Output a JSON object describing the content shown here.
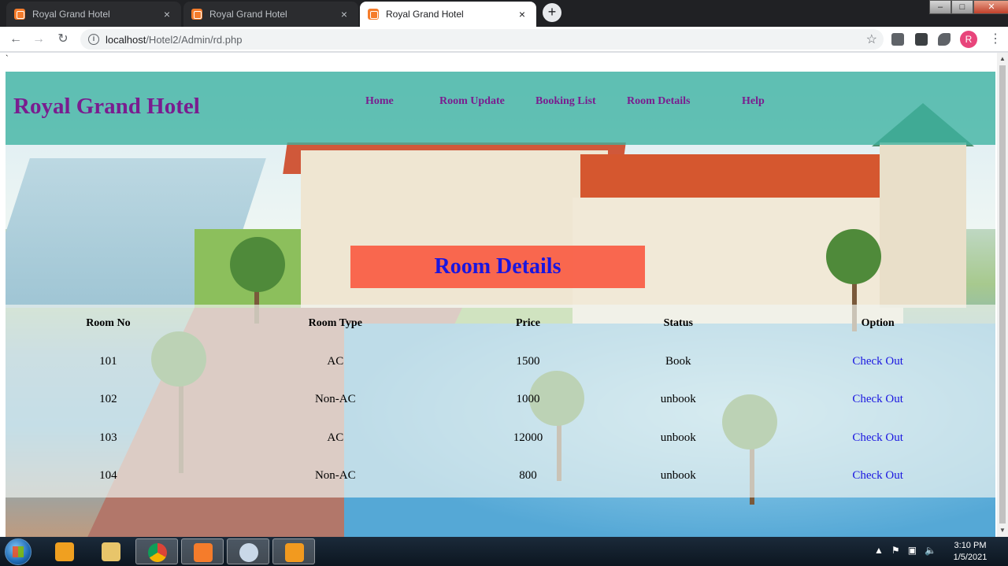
{
  "browser": {
    "tabs": [
      {
        "title": "Royal Grand Hotel",
        "active": false
      },
      {
        "title": "Royal Grand Hotel",
        "active": false
      },
      {
        "title": "Royal Grand Hotel",
        "active": true
      }
    ],
    "close_glyph": "×",
    "new_tab_glyph": "+",
    "url_host": "localhost",
    "url_path": "/Hotel2/Admin/rd.php",
    "profile_initial": "R",
    "window_controls": {
      "minimize": "–",
      "maximize": "□",
      "close": "✕"
    }
  },
  "page": {
    "stray_char": "`",
    "brand": "Royal Grand Hotel",
    "nav": [
      "Home",
      "Room Update",
      "Booking List",
      "Room Details",
      "Help"
    ],
    "heading": "Room Details",
    "table": {
      "headers": [
        "Room No",
        "Room Type",
        "Price",
        "Status",
        "Option"
      ],
      "rows": [
        {
          "room_no": "101",
          "type": "AC",
          "price": "1500",
          "status": "Book",
          "option": "Check Out"
        },
        {
          "room_no": "102",
          "type": "Non-AC",
          "price": "1000",
          "status": "unbook",
          "option": "Check Out"
        },
        {
          "room_no": "103",
          "type": "AC",
          "price": "12000",
          "status": "unbook",
          "option": "Check Out"
        },
        {
          "room_no": "104",
          "type": "Non-AC",
          "price": "800",
          "status": "unbook",
          "option": "Check Out"
        }
      ]
    },
    "colors": {
      "brand": "#7a1d8f",
      "heading": "#1a16e0",
      "header_band": "#3cb2a0",
      "title_box": "#fa5037",
      "link": "#1a16e0"
    }
  },
  "taskbar": {
    "apps": [
      "windows-media-player",
      "file-explorer",
      "chrome",
      "xampp",
      "paint",
      "sublime-text"
    ],
    "time": "3:10 PM",
    "date": "1/5/2021"
  }
}
